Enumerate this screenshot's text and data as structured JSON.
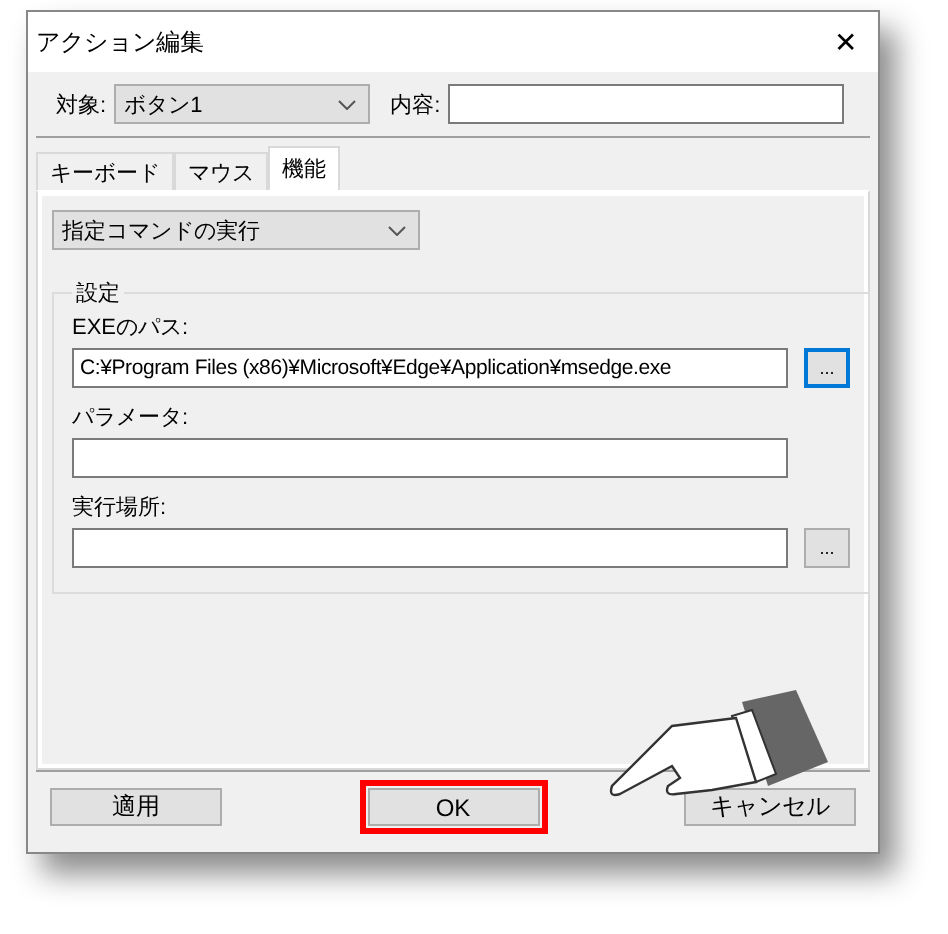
{
  "window": {
    "title": "アクション編集",
    "close": "✕"
  },
  "target": {
    "label": "対象:",
    "value": "ボタン1"
  },
  "content": {
    "label": "内容:"
  },
  "tabs": [
    {
      "label": "キーボード",
      "selected": false
    },
    {
      "label": "マウス",
      "selected": false
    },
    {
      "label": "機能",
      "selected": true
    }
  ],
  "function_select": {
    "value": "指定コマンドの実行"
  },
  "settings": {
    "title": "設定",
    "fields": [
      {
        "label": "EXEのパス:",
        "value": "C:¥Program Files (x86)¥Microsoft¥Edge¥Application¥msedge.exe",
        "browse": "...",
        "focused": true
      },
      {
        "label": "パラメータ:"
      },
      {
        "label": "実行場所:",
        "browse": "...",
        "focused": false
      }
    ]
  },
  "buttons": [
    {
      "label": "適用",
      "highlighted": false
    },
    {
      "label": "OK",
      "highlighted": true
    },
    {
      "label": "キャンセル",
      "highlighted": false
    }
  ]
}
